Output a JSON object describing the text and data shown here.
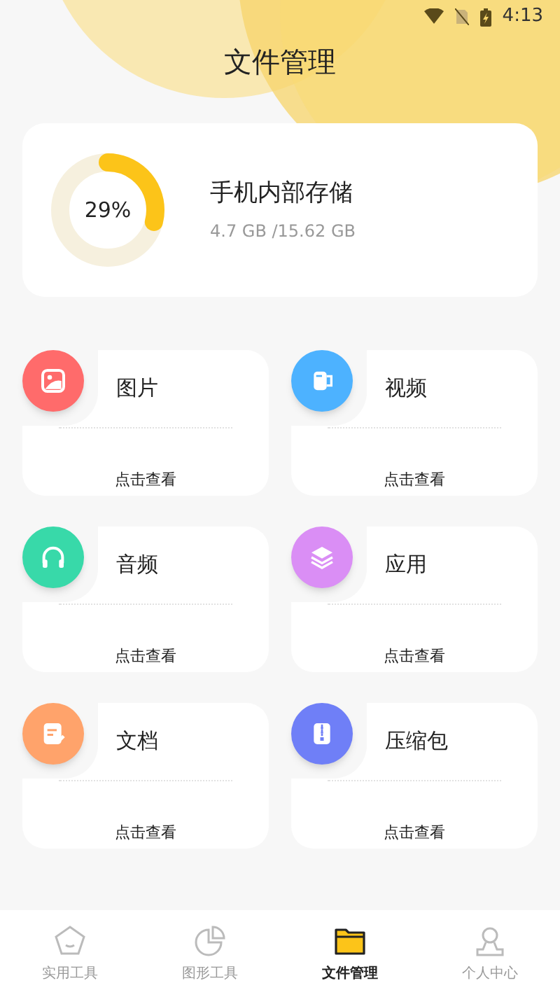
{
  "status_bar": {
    "time": "4:13"
  },
  "title": "文件管理",
  "storage": {
    "percent": "29%",
    "level": 0.29,
    "name": "手机内部存储",
    "usage": "4.7 GB /15.62 GB"
  },
  "categories": [
    {
      "label": "图片",
      "action": "点击查看",
      "color": "#ff6b6b"
    },
    {
      "label": "视频",
      "action": "点击查看",
      "color": "#4db2ff"
    },
    {
      "label": "音频",
      "action": "点击查看",
      "color": "#38d9a9"
    },
    {
      "label": "应用",
      "action": "点击查看",
      "color": "#da8ef5"
    },
    {
      "label": "文档",
      "action": "点击查看",
      "color": "#ffa36b"
    },
    {
      "label": "压缩包",
      "action": "点击查看",
      "color": "#6f7ff7"
    }
  ],
  "nav": [
    {
      "label": "实用工具",
      "selected": false
    },
    {
      "label": "图形工具",
      "selected": false
    },
    {
      "label": "文件管理",
      "selected": true
    },
    {
      "label": "个人中心",
      "selected": false
    }
  ]
}
